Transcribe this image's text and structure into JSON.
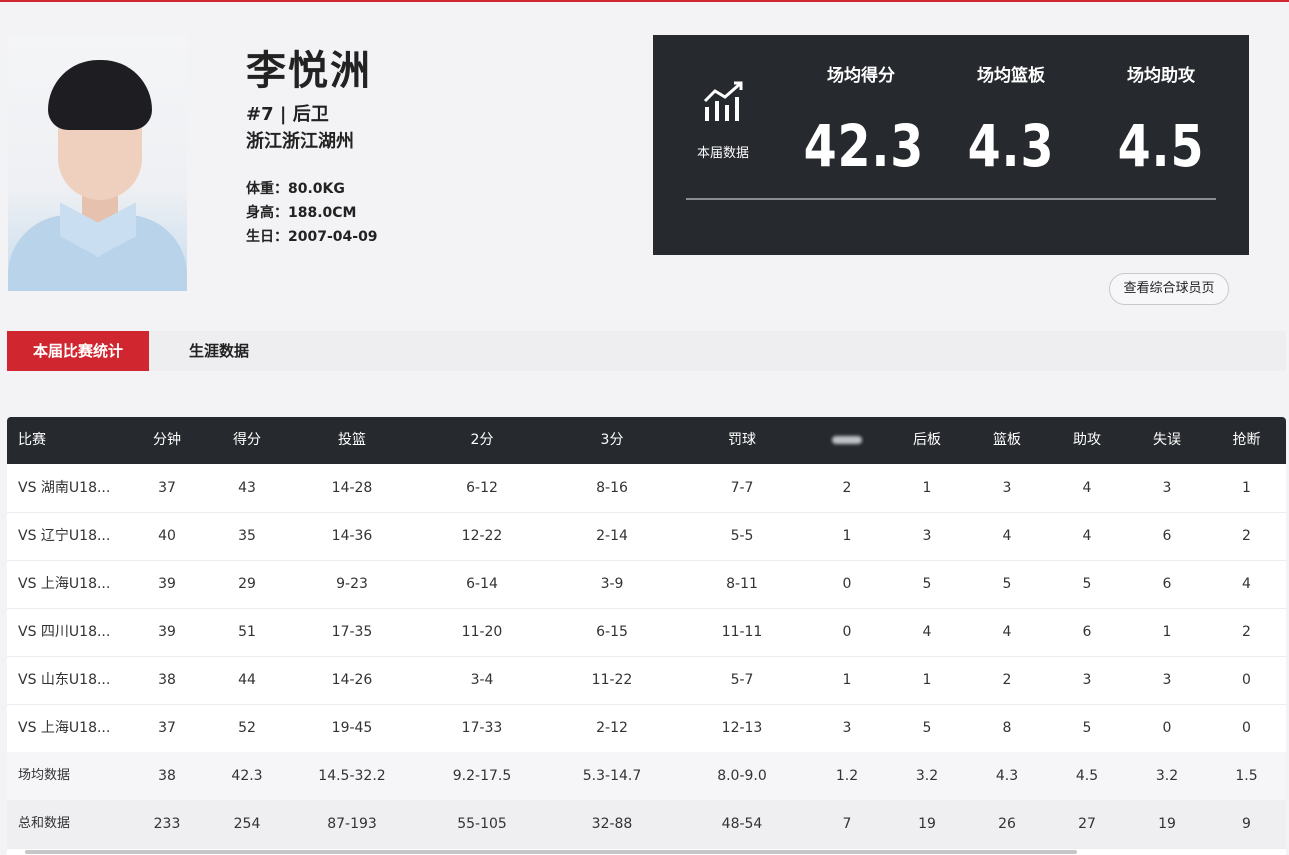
{
  "player": {
    "name": "李悦洲",
    "number_position": "#7 | 后卫",
    "hometown": "浙江浙江湖州",
    "weight": "体重：80.0KG",
    "height": "身高：188.0CM",
    "birthday": "生日：2007-04-09"
  },
  "season_stats": {
    "icon_label": "本届数据",
    "items": [
      {
        "label": "场均得分",
        "value": "42.3"
      },
      {
        "label": "场均篮板",
        "value": "4.3"
      },
      {
        "label": "场均助攻",
        "value": "4.5"
      }
    ]
  },
  "profile_button": "查看综合球员页",
  "tabs": [
    {
      "label": "本届比赛统计",
      "active": true
    },
    {
      "label": "生涯数据",
      "active": false
    }
  ],
  "table": {
    "columns": [
      "比赛",
      "分钟",
      "得分",
      "投篮",
      "2分",
      "3分",
      "罚球",
      "",
      "后板",
      "篮板",
      "助攻",
      "失误",
      "抢断"
    ],
    "rows": [
      [
        "VS 湖南U18...",
        "37",
        "43",
        "14-28",
        "6-12",
        "8-16",
        "7-7",
        "2",
        "1",
        "3",
        "4",
        "3",
        "1"
      ],
      [
        "VS 辽宁U18...",
        "40",
        "35",
        "14-36",
        "12-22",
        "2-14",
        "5-5",
        "1",
        "3",
        "4",
        "4",
        "6",
        "2"
      ],
      [
        "VS 上海U18...",
        "39",
        "29",
        "9-23",
        "6-14",
        "3-9",
        "8-11",
        "0",
        "5",
        "5",
        "5",
        "6",
        "4"
      ],
      [
        "VS 四川U18...",
        "39",
        "51",
        "17-35",
        "11-20",
        "6-15",
        "11-11",
        "0",
        "4",
        "4",
        "6",
        "1",
        "2"
      ],
      [
        "VS 山东U18...",
        "38",
        "44",
        "14-26",
        "3-4",
        "11-22",
        "5-7",
        "1",
        "1",
        "2",
        "3",
        "3",
        "0"
      ],
      [
        "VS 上海U18...",
        "37",
        "52",
        "19-45",
        "17-33",
        "2-12",
        "12-13",
        "3",
        "5",
        "8",
        "5",
        "0",
        "0"
      ],
      [
        "场均数据",
        "38",
        "42.3",
        "14.5-32.2",
        "9.2-17.5",
        "5.3-14.7",
        "8.0-9.0",
        "1.2",
        "3.2",
        "4.3",
        "4.5",
        "3.2",
        "1.5"
      ],
      [
        "总和数据",
        "233",
        "254",
        "87-193",
        "55-105",
        "32-88",
        "48-54",
        "7",
        "19",
        "26",
        "27",
        "19",
        "9"
      ]
    ]
  },
  "colors": {
    "accent_red": "#d0262f",
    "panel_dark": "#26292d"
  }
}
